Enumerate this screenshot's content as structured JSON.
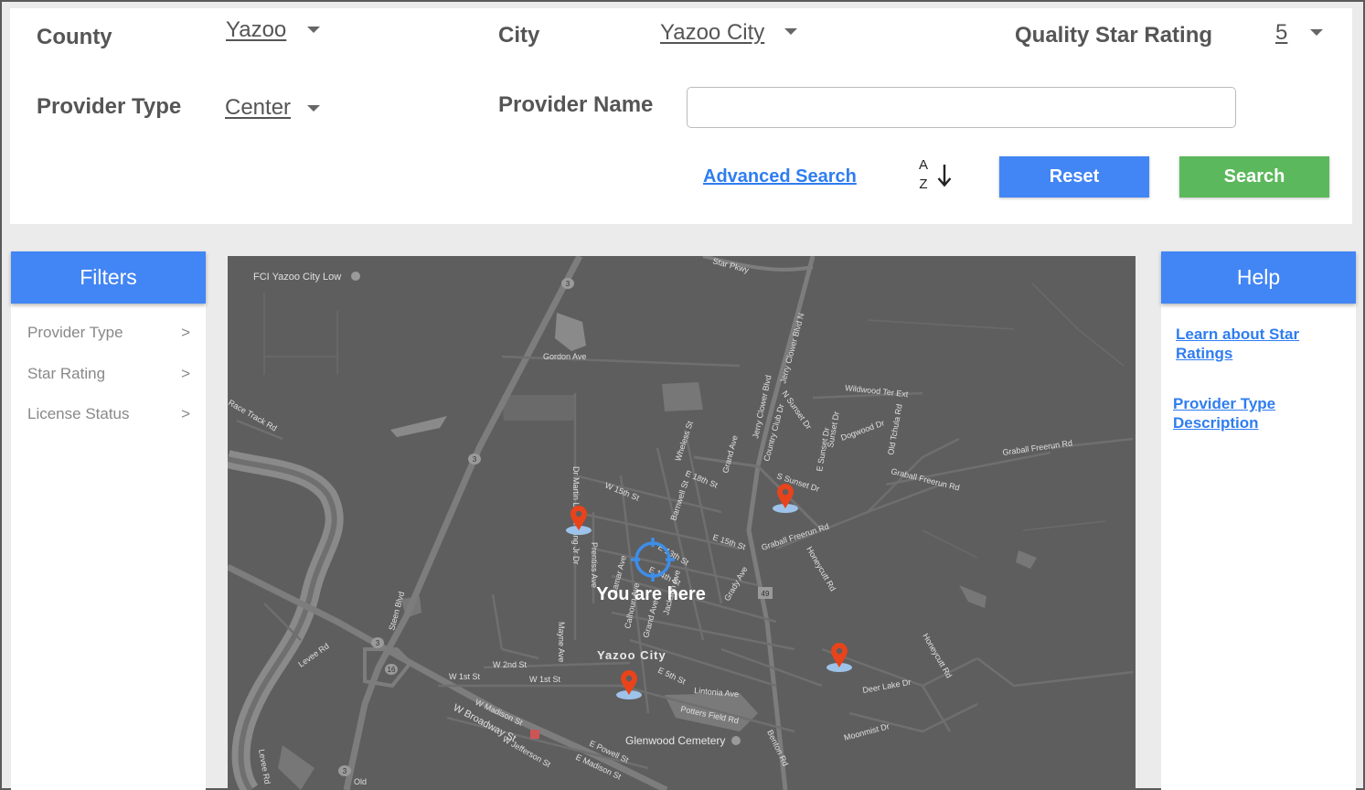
{
  "search": {
    "county_label": "County",
    "county_value": "Yazoo",
    "city_label": "City",
    "city_value": "Yazoo City",
    "rating_label": "Quality Star Rating",
    "rating_value": "5",
    "provider_type_label": "Provider Type",
    "provider_type_value": "Center",
    "provider_name_label": "Provider Name",
    "provider_name_value": "",
    "provider_name_placeholder": "",
    "advanced_search": "Advanced Search",
    "sort_icon": "sort-a-z-icon",
    "sort_a": "A",
    "sort_z": "Z",
    "reset": "Reset",
    "search": "Search"
  },
  "filters": {
    "title": "Filters",
    "items": [
      {
        "label": "Provider Type",
        "chevron": ">"
      },
      {
        "label": "Star Rating",
        "chevron": ">"
      },
      {
        "label": "License Status",
        "chevron": ">"
      }
    ]
  },
  "help": {
    "title": "Help",
    "links": [
      "Learn about Star Ratings",
      "Provider Type Description"
    ]
  },
  "map": {
    "you_are_here": "You are here",
    "marker_icon": "map-pin-icon",
    "location_icon": "crosshair-icon",
    "colors": {
      "background": "#5e5e5e",
      "road": "#7a7a7a",
      "water": "#888888",
      "marker": "#e8431b",
      "marker_shadow": "#9ec3ea",
      "locator": "#3d8ee8"
    },
    "labels": {
      "fci": "FCI Yazoo City Low",
      "city": "Yazoo City",
      "cemetery": "Glenwood Cemetery",
      "gordon": "Gordon Ave",
      "race_track": "Race Track Rd",
      "wildwood": "Wildwood Ter Ext",
      "graball1": "Graball Freerun Rd",
      "graball2": "Graball Freerun Rd",
      "graball3": "Graball Freerun Rd",
      "jerry_n": "Jerry Clower Blvd N",
      "jerry": "Jerry Clower Blvd",
      "pkwy": "Star Pkwy",
      "w15": "W 15th St",
      "e15": "E 15th St",
      "e18": "E 18th St",
      "e13": "E 13th St",
      "e14": "E 14th St",
      "e5": "E 5th St",
      "w2": "W 2nd St",
      "w1a": "W 1st St",
      "w1b": "W 1st St",
      "madison": "W Madison St",
      "broadway": "W Broadway St",
      "jefferson": "W Jefferson St",
      "e_powell": "E Powell St",
      "e_madison": "E Madison St",
      "linton": "Lintonia Ave",
      "potters": "Potters Field Rd",
      "deer": "Deer Lake Dr",
      "moonmist": "Moonmist Dr",
      "honeycutt1": "Honeycutt Rd",
      "honeycutt2": "Honeycutt Rd",
      "levee": "Levee Rd",
      "levee2": "Levee Rd",
      "steen": "Steen Blvd",
      "mlk": "Dr Martin Luther King Jr Dr",
      "prentiss": "Prentiss Ave",
      "mayne": "Mayne Ave",
      "calhoun": "Calhoun Ave",
      "grand": "Grand Ave",
      "grand2": "Grand Ave",
      "jackson": "Jackson Ave",
      "grady": "Grady Ave",
      "barnwell": "Barnwell St",
      "wheless": "Wheless St",
      "country_club": "Country Club Dr",
      "n_sunset": "N Sunset Dr",
      "s_sunset": "S Sunset Dr",
      "sunset_dr": "Sunset Dr",
      "e_sunset": "E Sunset Dr",
      "dogwood": "Dogwood Dr",
      "old_tchula": "Old Tchula Rd",
      "benton": "Benton Rd",
      "lamar": "Lamar Ave",
      "hwy3a": "3",
      "hwy3b": "3",
      "hwy3c": "3",
      "hwy49": "49",
      "hwy16": "16",
      "hwy3d": "3",
      "old": "Old"
    }
  }
}
